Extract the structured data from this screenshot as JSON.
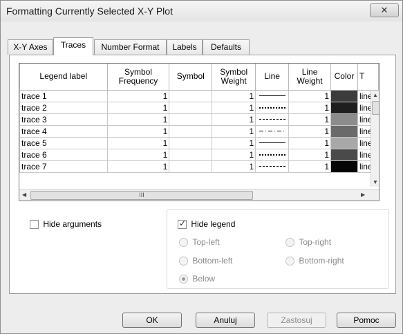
{
  "window": {
    "title": "Formatting Currently Selected X-Y Plot",
    "close_glyph": "✕"
  },
  "tabs": [
    {
      "label": "X-Y Axes"
    },
    {
      "label": "Traces"
    },
    {
      "label": "Number Format"
    },
    {
      "label": "Labels"
    },
    {
      "label": "Defaults"
    }
  ],
  "grid": {
    "columns": {
      "legend_label": "Legend label",
      "symbol_frequency_1": "Symbol",
      "symbol_frequency_2": "Frequency",
      "symbol": "Symbol",
      "symbol_weight_1": "Symbol",
      "symbol_weight_2": "Weight",
      "line": "Line",
      "line_weight_1": "Line",
      "line_weight_2": "Weight",
      "color": "Color",
      "type": "T"
    },
    "rows": [
      {
        "label": "trace 1",
        "symbol_frequency": "1",
        "symbol": "",
        "symbol_weight": "1",
        "line_style": "solid",
        "line_weight": "1",
        "color": "#3c3c3c",
        "type": "line"
      },
      {
        "label": "trace 2",
        "symbol_frequency": "1",
        "symbol": "",
        "symbol_weight": "1",
        "line_style": "dot",
        "line_weight": "1",
        "color": "#1e1e1e",
        "type": "line"
      },
      {
        "label": "trace 3",
        "symbol_frequency": "1",
        "symbol": "",
        "symbol_weight": "1",
        "line_style": "dash",
        "line_weight": "1",
        "color": "#8c8c8c",
        "type": "line"
      },
      {
        "label": "trace 4",
        "symbol_frequency": "1",
        "symbol": "",
        "symbol_weight": "1",
        "line_style": "dashdot",
        "line_weight": "1",
        "color": "#6a6a6a",
        "type": "line"
      },
      {
        "label": "trace 5",
        "symbol_frequency": "1",
        "symbol": "",
        "symbol_weight": "1",
        "line_style": "solid",
        "line_weight": "1",
        "color": "#a8a8a8",
        "type": "line"
      },
      {
        "label": "trace 6",
        "symbol_frequency": "1",
        "symbol": "",
        "symbol_weight": "1",
        "line_style": "dot",
        "line_weight": "1",
        "color": "#4a4a4a",
        "type": "line"
      },
      {
        "label": "trace 7",
        "symbol_frequency": "1",
        "symbol": "",
        "symbol_weight": "1",
        "line_style": "dash",
        "line_weight": "1",
        "color": "#050505",
        "type": "line"
      }
    ],
    "hscroll_grip": "III"
  },
  "options": {
    "hide_arguments": {
      "label": "Hide arguments",
      "checked": false
    },
    "hide_legend": {
      "label": "Hide legend",
      "checked": true
    },
    "legend_positions": {
      "top_left": "Top-left",
      "top_right": "Top-right",
      "bottom_left": "Bottom-left",
      "bottom_right": "Bottom-right",
      "below": "Below"
    },
    "selected_position": "Below"
  },
  "buttons": {
    "ok": "OK",
    "cancel": "Anuluj",
    "apply": "Zastosuj",
    "help": "Pomoc"
  }
}
